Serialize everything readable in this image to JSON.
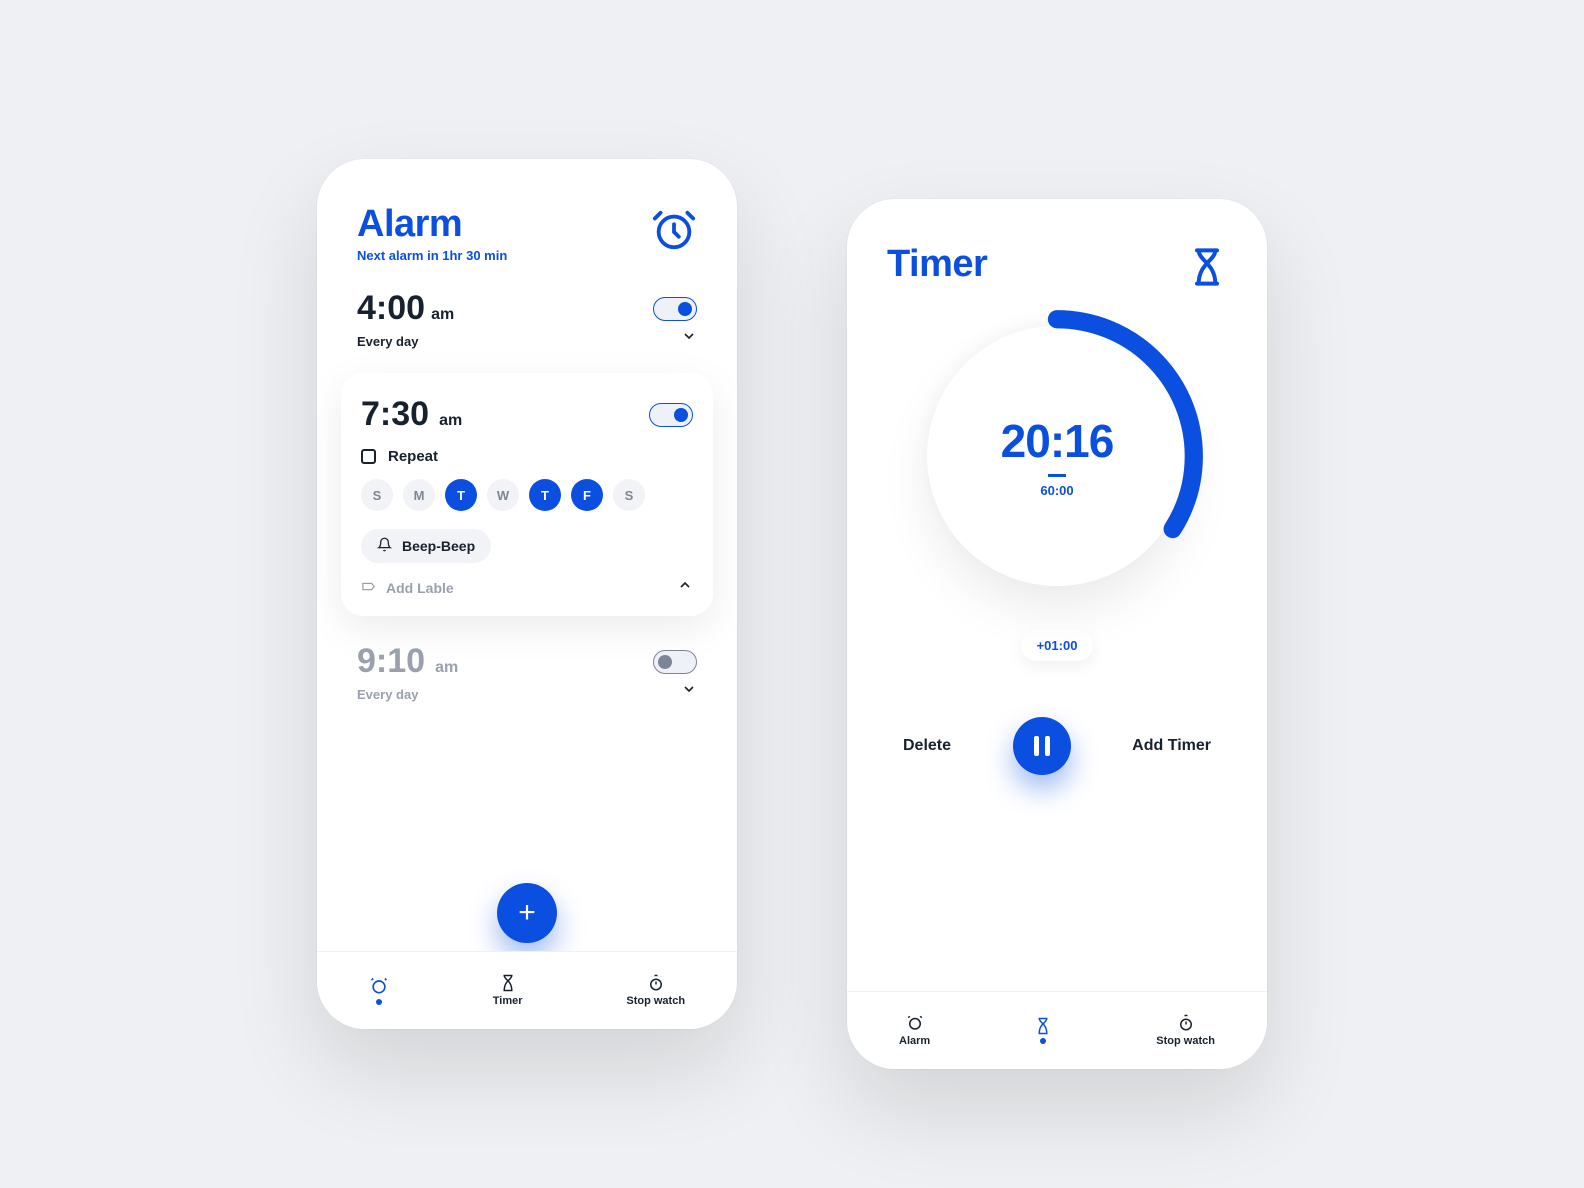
{
  "alarm": {
    "title": "Alarm",
    "subtitle": "Next alarm in 1hr 30 min",
    "items": [
      {
        "time": "4:00",
        "ampm": "am",
        "sub": "Every day",
        "enabled": true,
        "expanded": false
      },
      {
        "time": "7:30",
        "ampm": "am",
        "repeat_label": "Repeat",
        "enabled": true,
        "expanded": true,
        "days": [
          {
            "label": "S",
            "on": false
          },
          {
            "label": "M",
            "on": false
          },
          {
            "label": "T",
            "on": true
          },
          {
            "label": "W",
            "on": false
          },
          {
            "label": "T",
            "on": true
          },
          {
            "label": "F",
            "on": true
          },
          {
            "label": "S",
            "on": false
          }
        ],
        "sound": "Beep-Beep",
        "add_label": "Add Lable"
      },
      {
        "time": "9:10",
        "ampm": "am",
        "sub": "Every day",
        "enabled": false,
        "expanded": false
      }
    ],
    "nav": {
      "alarm": "",
      "timer": "Timer",
      "stopwatch": "Stop watch",
      "active": "alarm"
    }
  },
  "timer": {
    "title": "Timer",
    "elapsed": "20:16",
    "total": "60:00",
    "add_minute": "+01:00",
    "progress_fraction": 0.34,
    "actions": {
      "delete": "Delete",
      "add": "Add Timer"
    },
    "nav": {
      "alarm": "Alarm",
      "timer": "",
      "stopwatch": "Stop watch",
      "active": "timer"
    }
  }
}
